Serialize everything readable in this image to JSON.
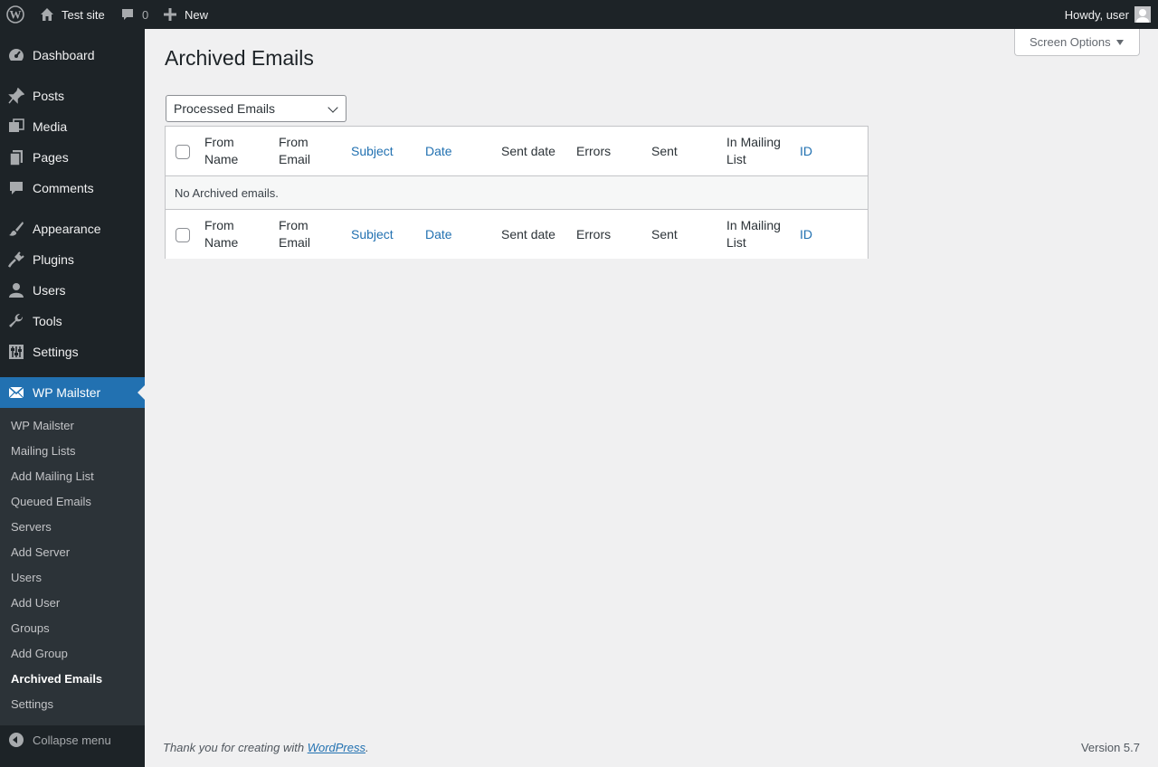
{
  "adminbar": {
    "site_name": "Test site",
    "comments_count": "0",
    "new_label": "New",
    "howdy": "Howdy, user"
  },
  "menu": {
    "dashboard": "Dashboard",
    "posts": "Posts",
    "media": "Media",
    "pages": "Pages",
    "comments": "Comments",
    "appearance": "Appearance",
    "plugins": "Plugins",
    "users": "Users",
    "tools": "Tools",
    "settings": "Settings",
    "wp_mailster": "WP Mailster"
  },
  "submenu": [
    "WP Mailster",
    "Mailing Lists",
    "Add Mailing List",
    "Queued Emails",
    "Servers",
    "Add Server",
    "Users",
    "Add User",
    "Groups",
    "Add Group",
    "Archived Emails",
    "Settings"
  ],
  "collapse_label": "Collapse menu",
  "screen_options": "Screen Options",
  "page_title": "Archived Emails",
  "filter": {
    "selected": "Processed Emails"
  },
  "table": {
    "columns": [
      {
        "label": "From\nName",
        "sortable": false
      },
      {
        "label": "From\nEmail",
        "sortable": false
      },
      {
        "label": "Subject",
        "sortable": true
      },
      {
        "label": "Date",
        "sortable": true
      },
      {
        "label": "Sent date",
        "sortable": false
      },
      {
        "label": "Errors",
        "sortable": false
      },
      {
        "label": "Sent",
        "sortable": false
      },
      {
        "label": "In Mailing\nList",
        "sortable": false
      },
      {
        "label": "ID",
        "sortable": true
      }
    ],
    "empty_message": "No Archived emails."
  },
  "footer": {
    "thanks_prefix": "Thank you for creating with ",
    "thanks_link": "WordPress",
    "thanks_suffix": ".",
    "version": "Version 5.7"
  },
  "colors": {
    "admin_bar_bg": "#1d2327",
    "menu_bg": "#1d2327",
    "submenu_bg": "#2c3338",
    "accent": "#2271b1",
    "page_bg": "#f0f0f1"
  }
}
